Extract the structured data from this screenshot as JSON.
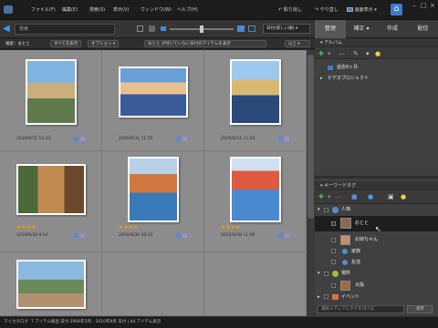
{
  "menu": {
    "items": [
      "ファイル(F)",
      "編集(E)",
      "検索(S)",
      "表示(V)",
      "ウィンドウ(W)",
      "ヘルプ(H)"
    ],
    "undo": "取り消し",
    "redo": "やり直し",
    "display": "画面表示"
  },
  "tabs": [
    "整理",
    "補正",
    "作成",
    "配信"
  ],
  "search": {
    "placeholder": "検索"
  },
  "sort": {
    "value": "日付(新しい順)"
  },
  "filter": {
    "label": "検索：おとと",
    "show_all": "すべてを表示",
    "options": "オプション",
    "not_match": "おとと が付いていない日付のアイテムを表示",
    "match": "以上"
  },
  "photos": [
    {
      "date": "2010/8/31 11:33",
      "stars": "",
      "tags": [
        "#5a8ad0",
        "#a08ad8"
      ]
    },
    {
      "date": "2010/8/31 11:55",
      "stars": "",
      "tags": [
        "#5a8ad0",
        "#a08ad8"
      ]
    },
    {
      "date": "2010/8/31 11:54",
      "stars": "",
      "tags": [
        "#5a8ad0",
        "#a08ad8"
      ]
    },
    {
      "date": "2010/8/30 9:54",
      "stars": "★★★★",
      "tags": [
        "#5a8ad0",
        "#a08ad8"
      ]
    },
    {
      "date": "2010/8/30 10:15",
      "stars": "★★★★",
      "tags": [
        "#5a8ad0",
        "#a08ad8"
      ]
    },
    {
      "date": "2010/8/30 11:06",
      "stars": "★★★★",
      "tags": [
        "#5a8ad0",
        "#a08ad8"
      ]
    },
    {
      "date": "",
      "stars": "",
      "tags": []
    }
  ],
  "album": {
    "title": "アルバム",
    "items": [
      "過去6ヶ月",
      "ビデオプロジェクト"
    ]
  },
  "keywords": {
    "title": "キーワードタグ",
    "items": [
      "人物",
      "おとと",
      "お姉ちゃん",
      "家族",
      "友達",
      "場所",
      "大阪",
      "イベント"
    ],
    "input_placeholder": "選択メディアにタグを付ける",
    "apply": "適用"
  },
  "status": {
    "catalog": "マイカタログ",
    "info": "7 アイテム検出 日付 2006年5月 - 2010年9月  日付 | 64 アイテム表示"
  }
}
